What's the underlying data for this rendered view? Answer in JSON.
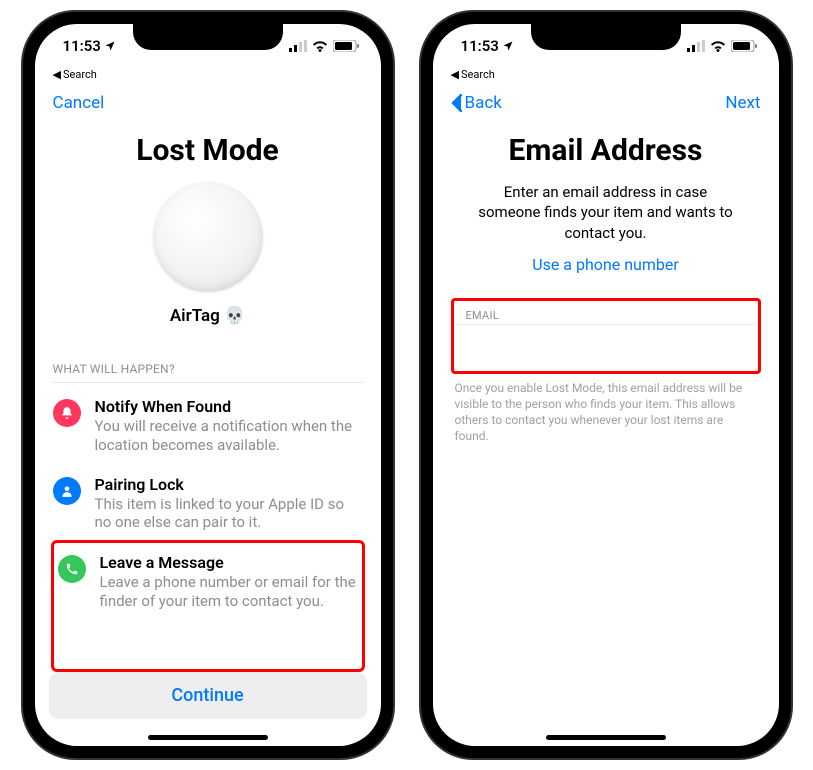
{
  "status": {
    "time": "11:53",
    "back_search": "Search"
  },
  "screen1": {
    "nav": {
      "cancel": "Cancel"
    },
    "title": "Lost Mode",
    "item_name": "AirTag 💀",
    "section_header": "WHAT WILL HAPPEN?",
    "rows": [
      {
        "title": "Notify When Found",
        "desc": "You will receive a notification when the location becomes available."
      },
      {
        "title": "Pairing Lock",
        "desc": "This item is linked to your Apple ID so no one else can pair to it."
      },
      {
        "title": "Leave a Message",
        "desc": "Leave a phone number or email for the finder of your item to contact you."
      }
    ],
    "continue": "Continue"
  },
  "screen2": {
    "nav": {
      "back": "Back",
      "next": "Next"
    },
    "title": "Email Address",
    "subtitle": "Enter an email address in case someone finds your item and wants to contact you.",
    "use_phone": "Use a phone number",
    "email_label": "EMAIL",
    "email_placeholder": "",
    "footnote": "Once you enable Lost Mode, this email address will be visible to the person who finds your item. This allows others to contact you whenever your lost items are found."
  }
}
